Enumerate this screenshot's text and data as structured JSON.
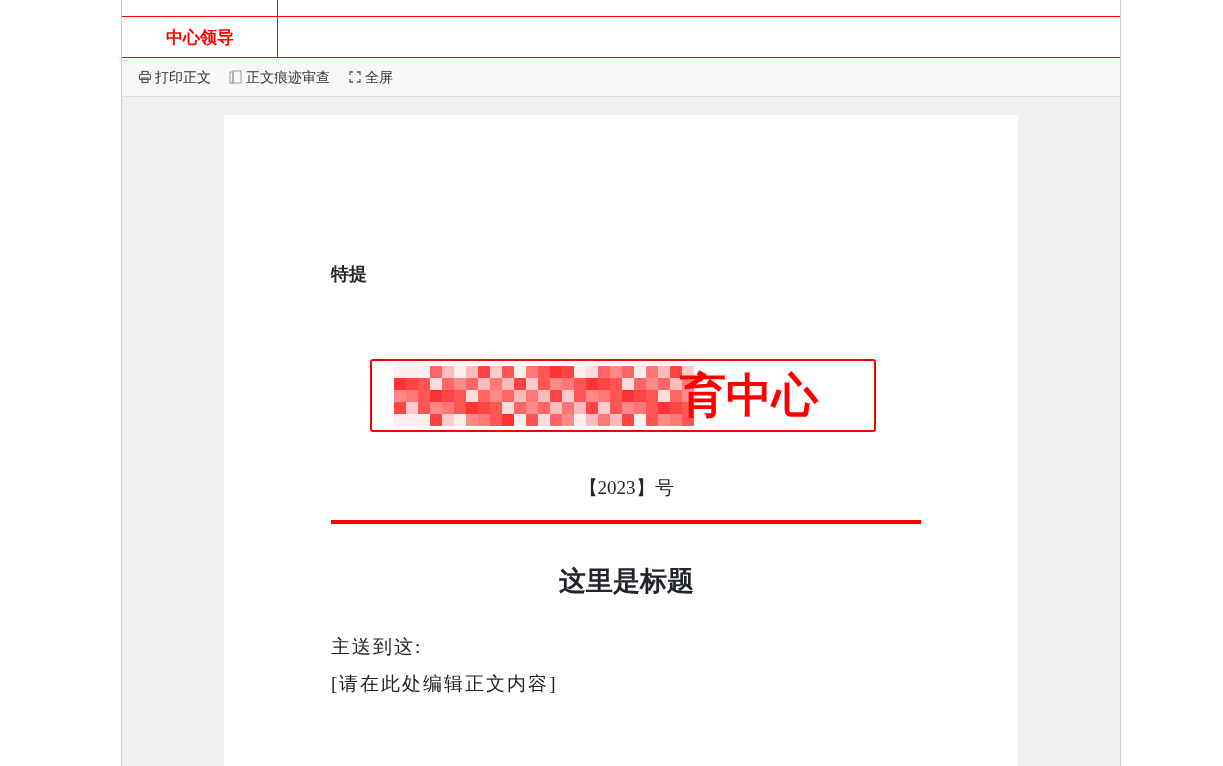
{
  "approval_rows": [
    {
      "label": "中心领导"
    }
  ],
  "toolbar": [
    {
      "kind": "print",
      "label": "打印正文"
    },
    {
      "kind": "revision",
      "label": "正文痕迹审查"
    },
    {
      "kind": "fullscreen",
      "label": "全屏"
    }
  ],
  "document": {
    "urgency": "特提",
    "header_visible": "育中心",
    "doc_number": "【2023】号",
    "title": "这里是标题",
    "recipient": "主送到这:",
    "body": "[请在此处编辑正文内容]"
  }
}
